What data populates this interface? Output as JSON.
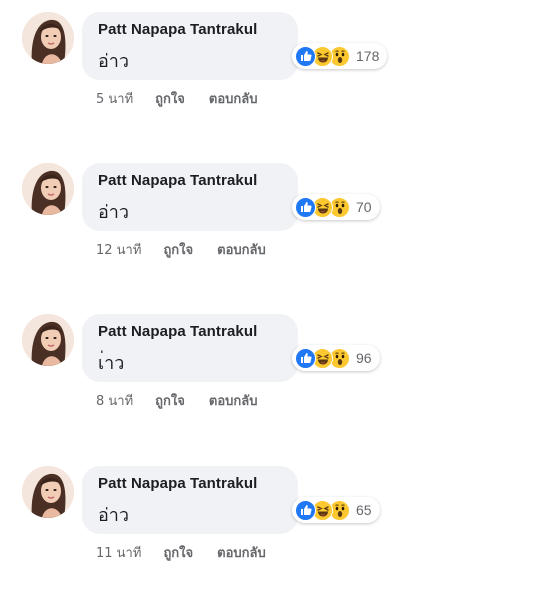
{
  "comments": [
    {
      "author": "Patt Napapa Tantrakul",
      "text": "อ่าว",
      "reaction_count": "178",
      "time": "5 นาที",
      "like_label": "ถูกใจ",
      "reply_label": "ตอบกลับ"
    },
    {
      "author": "Patt Napapa Tantrakul",
      "text": "อ่าว",
      "reaction_count": "70",
      "time": "12 นาที",
      "like_label": "ถูกใจ",
      "reply_label": "ตอบกลับ"
    },
    {
      "author": "Patt Napapa Tantrakul",
      "text": "เ่าว",
      "reaction_count": "96",
      "time": "8 นาที",
      "like_label": "ถูกใจ",
      "reply_label": "ตอบกลับ"
    },
    {
      "author": "Patt Napapa Tantrakul",
      "text": "อ่าว",
      "reaction_count": "65",
      "time": "11 นาที",
      "like_label": "ถูกใจ",
      "reply_label": "ตอบกลับ"
    }
  ],
  "reaction_icons": [
    "like-icon",
    "haha-icon",
    "wow-icon"
  ],
  "colors": {
    "bubble": "#f0f2f5",
    "like_blue": "#2078f4",
    "emoji_yellow": "#fbc82f",
    "meta_gray": "#65676b"
  }
}
